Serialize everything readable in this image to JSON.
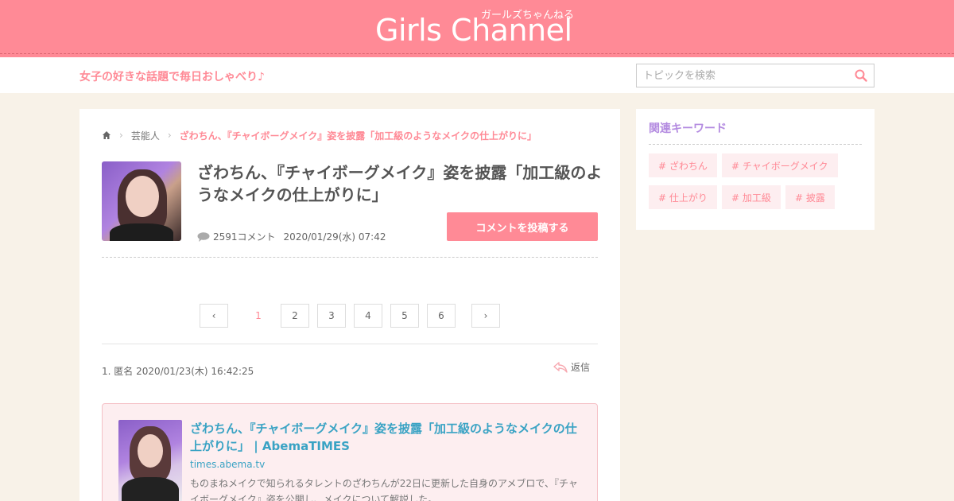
{
  "site": {
    "logo_ruby": "ガールズちゃんねる",
    "logo_text": "Girls Channel",
    "tagline": "女子の好きな話題で毎日おしゃべり♪"
  },
  "search": {
    "placeholder": "トピックを検索"
  },
  "breadcrumb": {
    "category": "芸能人",
    "current": "ざわちん、『チャイボーグメイク』姿を披露「加工級のようなメイクの仕上がりに」"
  },
  "topic": {
    "title": "ざわちん、『チャイボーグメイク』姿を披露「加工級のようなメイクの仕上がりに」",
    "comment_count": "2591コメント",
    "date": "2020/01/29(水) 07:42",
    "post_button": "コメントを投稿する"
  },
  "pager": {
    "prev": "‹",
    "next": "›",
    "pages": [
      "1",
      "2",
      "3",
      "4",
      "5",
      "6"
    ],
    "current": "1"
  },
  "comment": {
    "header": "1. 匿名 2020/01/23(木) 16:42:25",
    "reply_label": "返信"
  },
  "card": {
    "title": "ざわちん、『チャイボーグメイク』姿を披露「加工級のようなメイクの仕上がりに」 | AbemaTIMES",
    "domain": "times.abema.tv",
    "description": "ものまねメイクで知られるタレントのざわちんが22日に更新した自身のアメブロで、『チャイボーグメイク』姿を公開し、メイクについて解説した。"
  },
  "sidebar": {
    "title": "関連キーワード",
    "keywords": [
      "# ざわちん",
      "# チャイボーグメイク",
      "# 仕上がり",
      "# 加工級",
      "# 披露"
    ]
  },
  "colors": {
    "brand_pink": "#ff8a96",
    "link_blue": "#3aa3c4",
    "sidebar_purple": "#b38ae0",
    "page_bg": "#f8f2e8"
  }
}
